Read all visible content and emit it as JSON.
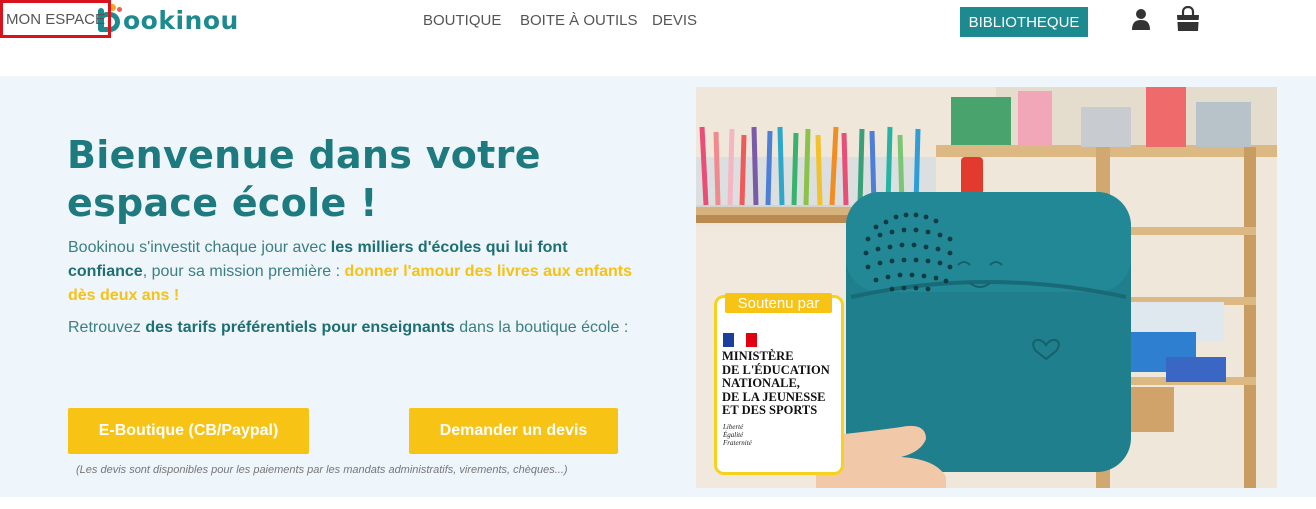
{
  "header": {
    "logo_text": "ookinou",
    "nav": {
      "boutique": "BOUTIQUE",
      "boite": "BOITE À OUTILS",
      "devis": "DEVIS",
      "espace": "MON ESPACE"
    },
    "bibliotheque": "BIBLIOTHEQUE",
    "icons": [
      "user-icon",
      "shopping-bag-icon"
    ],
    "colors": {
      "brand": "#1d8a8f",
      "highlight_border": "#d9131e"
    }
  },
  "hero": {
    "title": "Bienvenue dans votre espace école !",
    "para1": {
      "t1": "Bookinou s'investit chaque jour avec ",
      "b1": "les milliers d'écoles qui lui font confiance",
      "t2": ", pour sa mission première : ",
      "b2": "donner l'amour des livres aux enfants dès deux ans !"
    },
    "para2": {
      "t1": "Retrouvez ",
      "b1": "des tarifs préférentiels pour enseignants",
      "t2": " dans la boutique école :"
    },
    "buttons": {
      "eboutique": "E-Boutique (CB/Paypal)",
      "devis": "Demander un devis"
    },
    "devis_note": "(Les devis sont disponibles pour les paiements par les mandats administratifs, virements, chèques...)",
    "colors": {
      "accent_yellow": "#f7c315",
      "title_teal": "#1d7a7f",
      "background": "#eef5fb"
    }
  },
  "photo": {
    "badge_label": "Soutenu par",
    "ministry": [
      "MINISTÈRE",
      "DE L'ÉDUCATION",
      "NATIONALE,",
      "DE LA JEUNESSE",
      "ET DES SPORTS"
    ],
    "motto": [
      "Liberté",
      "Égalité",
      "Fraternité"
    ]
  }
}
